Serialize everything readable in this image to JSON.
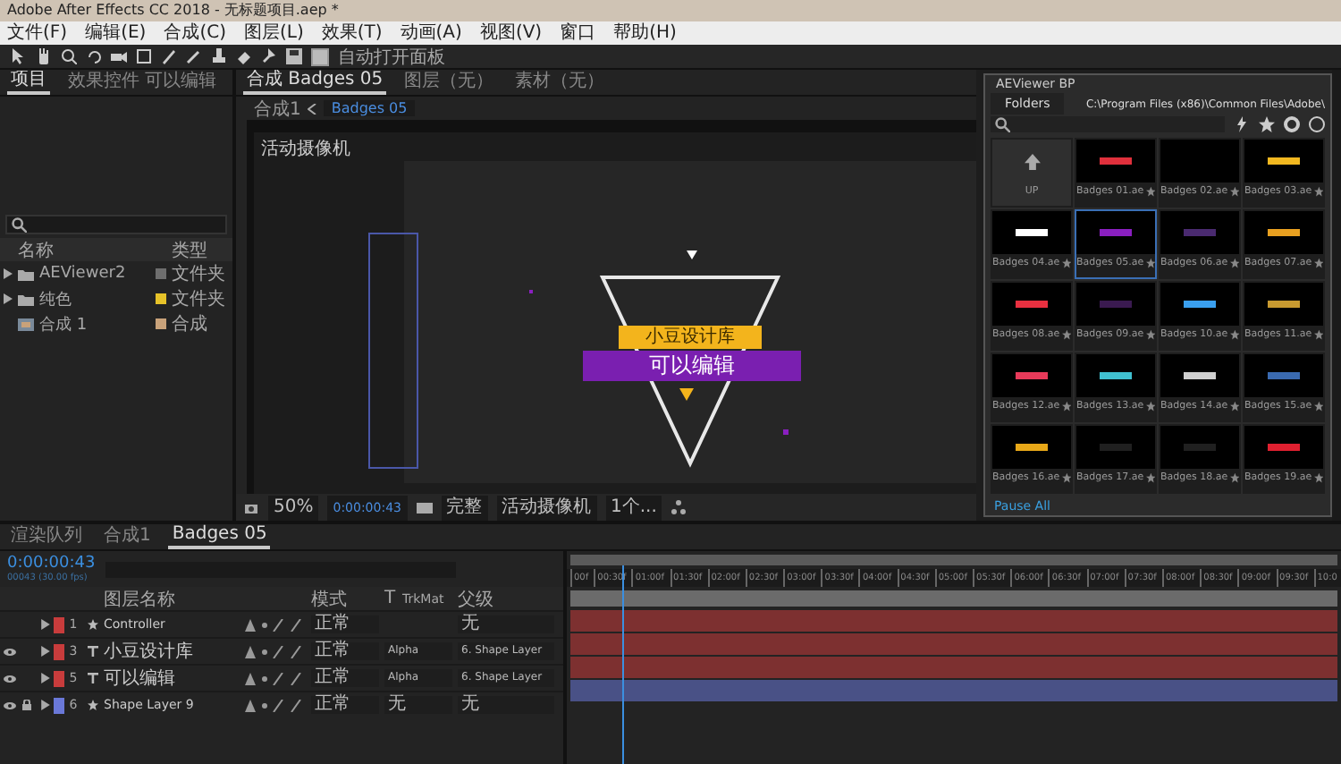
{
  "window": {
    "title": "Adobe After Effects CC 2018 - 无标题项目.aep *"
  },
  "menu": [
    "文件(F)",
    "编辑(E)",
    "合成(C)",
    "图层(L)",
    "效果(T)",
    "动画(A)",
    "视图(V)",
    "窗口",
    "帮助(H)"
  ],
  "toolbar": {
    "auto_open_label": "自动打开面板",
    "auto_open_checked": true
  },
  "project_panel": {
    "tabs": [
      {
        "label": "项目",
        "selected": true
      },
      {
        "label": "效果控件 可以编辑",
        "selected": false
      }
    ],
    "columns": [
      "名称",
      "类型"
    ],
    "items": [
      {
        "name": "AEViewer2",
        "type": "文件夹",
        "kind": "folder",
        "color": "#6e6e6e"
      },
      {
        "name": "纯色",
        "type": "文件夹",
        "kind": "folder",
        "color": "#e6c229"
      },
      {
        "name": "合成 1",
        "type": "合成",
        "kind": "comp",
        "color": "#c9a27a"
      }
    ]
  },
  "viewer": {
    "tabs": [
      {
        "label": "合成 Badges 05",
        "selected": true
      },
      {
        "label": "图层（无）",
        "selected": false
      },
      {
        "label": "素材（无）",
        "selected": false
      }
    ],
    "breadcrumb": [
      "合成1",
      "Badges 05"
    ],
    "camera_label": "活动摄像机",
    "badge": {
      "top_text": "小豆设计库",
      "main_text": "可以编辑"
    },
    "footer": {
      "zoom": "50%",
      "time": "0:00:00:43",
      "resolution": "完整",
      "camera": "活动摄像机",
      "views": "1个..."
    }
  },
  "aeviewer": {
    "title": "AEViewer BP",
    "folders_button": "Folders",
    "path": "C:\\Program Files (x86)\\Common Files\\Adobe\\",
    "up_label": "UP",
    "items": [
      {
        "label": "Badges 01.ae",
        "selected": false,
        "color": "#e0303c"
      },
      {
        "label": "Badges 02.ae",
        "selected": false
      },
      {
        "label": "Badges 03.ae",
        "selected": false,
        "color": "#f2b820"
      },
      {
        "label": "Badges 04.ae",
        "selected": false,
        "color": "#ffffff"
      },
      {
        "label": "Badges 05.ae",
        "selected": true,
        "color": "#8a1fc0"
      },
      {
        "label": "Badges 06.ae",
        "selected": false,
        "color": "#4a2a70"
      },
      {
        "label": "Badges 07.ae",
        "selected": false,
        "color": "#e8a020"
      },
      {
        "label": "Badges 08.ae",
        "selected": false,
        "color": "#e83040"
      },
      {
        "label": "Badges 09.ae",
        "selected": false,
        "color": "#3a1a50"
      },
      {
        "label": "Badges 10.ae",
        "selected": false,
        "color": "#3aa0f0"
      },
      {
        "label": "Badges 11.ae",
        "selected": false,
        "color": "#c89a30"
      },
      {
        "label": "Badges 12.ae",
        "selected": false,
        "color": "#e83a5a"
      },
      {
        "label": "Badges 13.ae",
        "selected": false,
        "color": "#40c0d0"
      },
      {
        "label": "Badges 14.ae",
        "selected": false,
        "color": "#d0d0d0"
      },
      {
        "label": "Badges 15.ae",
        "selected": false,
        "color": "#3a6ab0"
      },
      {
        "label": "Badges 16.ae",
        "selected": false,
        "color": "#e8a818"
      },
      {
        "label": "Badges 17.ae",
        "selected": false,
        "color": "#202020"
      },
      {
        "label": "Badges 18.ae",
        "selected": false,
        "color": "#202020"
      },
      {
        "label": "Badges 19.ae",
        "selected": false,
        "color": "#e02030"
      }
    ],
    "pause_label": "Pause All"
  },
  "timeline": {
    "tabs": [
      {
        "label": "渲染队列",
        "selected": false
      },
      {
        "label": "合成1",
        "selected": false
      },
      {
        "label": "Badges 05",
        "selected": true
      }
    ],
    "time": "0:00:00:43",
    "fps": "00043 (30.00 fps)",
    "columns": {
      "name": "图层名称",
      "mode": "模式",
      "t": "T",
      "trkmat": "TrkMat",
      "parent": "父级"
    },
    "layers": [
      {
        "number": "1",
        "kind": "shape",
        "name": "Controller",
        "color": "#c83c3c",
        "mode": "正常",
        "parent": "无",
        "visible": false,
        "locked": false
      },
      {
        "number": "3",
        "kind": "text",
        "name": "小豆设计库",
        "color": "#c83c3c",
        "mode": "正常",
        "trkmat": "Alpha",
        "parent": "6. Shape Layer",
        "visible": true,
        "locked": false
      },
      {
        "number": "5",
        "kind": "text",
        "name": "可以编辑",
        "color": "#c83c3c",
        "mode": "正常",
        "trkmat": "Alpha",
        "parent": "6. Shape Layer",
        "visible": true,
        "locked": false
      },
      {
        "number": "6",
        "kind": "shape",
        "name": "Shape Layer 9",
        "color": "#6a78d8",
        "mode": "正常",
        "trkmat": "无",
        "parent": "无",
        "visible": true,
        "locked": true
      }
    ],
    "ruler": [
      "00f",
      "00:30f",
      "01:00f",
      "01:30f",
      "02:00f",
      "02:30f",
      "03:00f",
      "03:30f",
      "04:00f",
      "04:30f",
      "05:00f",
      "05:30f",
      "06:00f",
      "06:30f",
      "07:00f",
      "07:30f",
      "08:00f",
      "08:30f",
      "09:00f",
      "09:30f",
      "10:0"
    ],
    "playhead": {
      "level": 0.072
    }
  }
}
